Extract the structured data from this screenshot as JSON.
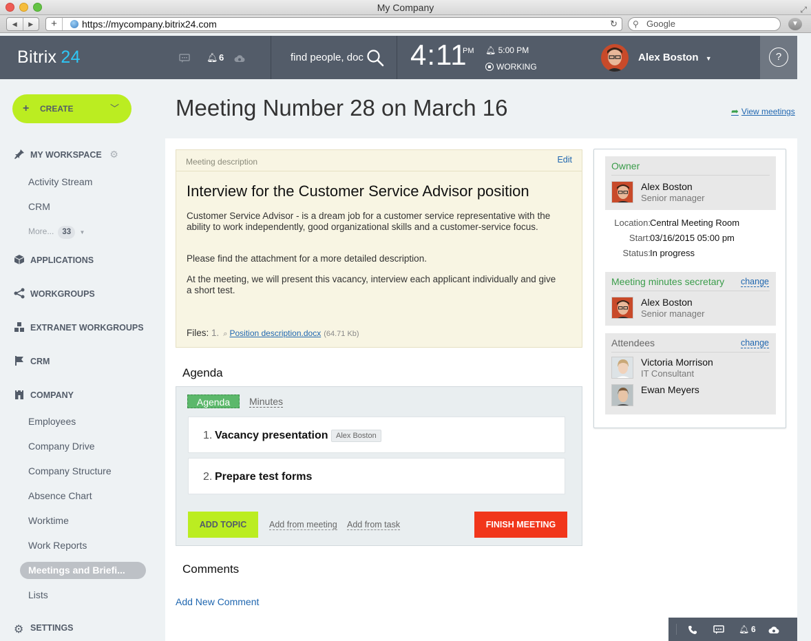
{
  "browser": {
    "window_title": "My Company",
    "url": "https://mycompany.bitrix24.com",
    "search_placeholder": "Google"
  },
  "header": {
    "logo_text": "Bitrix",
    "logo_number": "24",
    "notifications_count": "6",
    "search_placeholder": "find people, doc",
    "clock_time": "4:11",
    "clock_ampm": "PM",
    "alarm_time": "5:00 PM",
    "work_status": "WORKING",
    "user_name": "Alex Boston",
    "help_label": "?"
  },
  "sidebar": {
    "create_label": "CREATE",
    "sections": {
      "my_workspace": "MY WORKSPACE",
      "applications": "APPLICATIONS",
      "workgroups": "WORKGROUPS",
      "extranet": "EXTRANET WORKGROUPS",
      "crm": "CRM",
      "company": "COMPANY",
      "settings": "SETTINGS"
    },
    "workspace_items": [
      "Activity Stream",
      "CRM"
    ],
    "more_label": "More...",
    "more_count": "33",
    "company_items": [
      "Employees",
      "Company Drive",
      "Company Structure",
      "Absence Chart",
      "Worktime",
      "Work Reports",
      "Meetings and Briefi...",
      "Lists"
    ]
  },
  "page": {
    "title": "Meeting Number 28 on March 16",
    "view_meetings": "View meetings"
  },
  "description": {
    "label": "Meeting description",
    "edit": "Edit",
    "heading": "Interview for the Customer Service Advisor position",
    "paragraphs": [
      "Customer Service Advisor - is a dream job for a customer service representative with the ability to work independently, good organizational skills and a customer-service focus.",
      "Please find the attachment for a more detailed description.",
      "At the meeting, we will present this vacancy, interview each applicant individually and give a short test."
    ],
    "files_label": "Files:",
    "file_number": "1.",
    "file_name": "Position description.docx",
    "file_size": "(64.71 Kb)"
  },
  "agenda": {
    "title": "Agenda",
    "tab_agenda": "Agenda",
    "tab_minutes": "Minutes",
    "topics": [
      {
        "number": "1.",
        "text": "Vacancy presentation",
        "tag": "Alex Boston"
      },
      {
        "number": "2.",
        "text": "Prepare test forms",
        "tag": ""
      }
    ],
    "add_topic": "ADD TOPIC",
    "add_from_meeting": "Add from meeting",
    "add_from_task": "Add from task",
    "finish_meeting": "FINISH MEETING"
  },
  "comments": {
    "title": "Comments",
    "add_new": "Add New Comment"
  },
  "info": {
    "owner_title": "Owner",
    "owner": {
      "name": "Alex Boston",
      "role": "Senior manager"
    },
    "location_label": "Location:",
    "location": "Central Meeting Room",
    "start_label": "Start:",
    "start": "03/16/2015 05:00 pm",
    "status_label": "Status:",
    "status": "In progress",
    "secretary_title": "Meeting minutes secretary",
    "change_label": "change",
    "secretary": {
      "name": "Alex Boston",
      "role": "Senior manager"
    },
    "attendees_title": "Attendees",
    "attendees": [
      {
        "name": "Victoria Morrison",
        "role": "IT Consultant"
      },
      {
        "name": "Ewan Meyers",
        "role": ""
      }
    ]
  },
  "bottom_bar": {
    "notifications_count": "6"
  },
  "colors": {
    "header_bg": "#535c69",
    "accent_green": "#bbed21",
    "finish_red": "#f1361b",
    "link_blue": "#2067b0",
    "logo_blue": "#2fc6f6"
  }
}
